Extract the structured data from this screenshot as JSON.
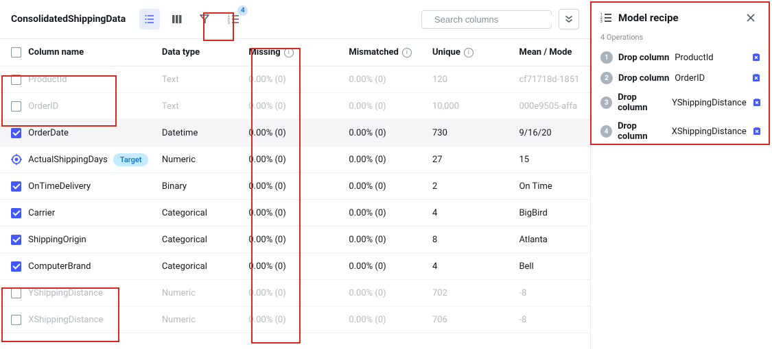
{
  "title": "ConsolidatedShippingData",
  "recipeBadge": "4",
  "search": {
    "placeholder": "Search columns"
  },
  "headers": {
    "name": "Column name",
    "type": "Data type",
    "missing": "Missing",
    "mismatched": "Mismatched",
    "unique": "Unique",
    "mean": "Mean / Mode"
  },
  "rows": [
    {
      "name": "ProductId",
      "type": "Text",
      "missing": "0.00% (0)",
      "mismatched": "0.00% (0)",
      "unique": "120",
      "mean": "cf71718d-1851",
      "checked": false,
      "target": false
    },
    {
      "name": "OrderID",
      "type": "Text",
      "missing": "0.00% (0)",
      "mismatched": "0.00% (0)",
      "unique": "10,000",
      "mean": "000e9505-affa",
      "checked": false,
      "target": false
    },
    {
      "name": "OrderDate",
      "type": "Datetime",
      "missing": "0.00% (0)",
      "mismatched": "0.00% (0)",
      "unique": "730",
      "mean": "9/16/20",
      "checked": true,
      "target": false,
      "current": true
    },
    {
      "name": "ActualShippingDays",
      "type": "Numeric",
      "missing": "0.00% (0)",
      "mismatched": "0.00% (0)",
      "unique": "27",
      "mean": "15",
      "checked": false,
      "target": true,
      "targetLabel": "Target"
    },
    {
      "name": "OnTimeDelivery",
      "type": "Binary",
      "missing": "0.00% (0)",
      "mismatched": "0.00% (0)",
      "unique": "2",
      "mean": "On Time",
      "checked": true,
      "target": false
    },
    {
      "name": "Carrier",
      "type": "Categorical",
      "missing": "0.00% (0)",
      "mismatched": "0.00% (0)",
      "unique": "4",
      "mean": "BigBird",
      "checked": true,
      "target": false
    },
    {
      "name": "ShippingOrigin",
      "type": "Categorical",
      "missing": "0.00% (0)",
      "mismatched": "0.00% (0)",
      "unique": "8",
      "mean": "Atlanta",
      "checked": true,
      "target": false
    },
    {
      "name": "ComputerBrand",
      "type": "Categorical",
      "missing": "0.00% (0)",
      "mismatched": "0.00% (0)",
      "unique": "4",
      "mean": "Bell",
      "checked": true,
      "target": false
    },
    {
      "name": "YShippingDistance",
      "type": "Numeric",
      "missing": "0.00% (0)",
      "mismatched": "0.00% (0)",
      "unique": "702",
      "mean": "-8",
      "checked": false,
      "target": false
    },
    {
      "name": "XShippingDistance",
      "type": "Numeric",
      "missing": "0.00% (0)",
      "mismatched": "0.00% (0)",
      "unique": "706",
      "mean": "-8",
      "checked": false,
      "target": false
    }
  ],
  "panel": {
    "title": "Model recipe",
    "opsCount": "4 Operations",
    "ops": [
      {
        "action": "Drop column",
        "column": "ProductId"
      },
      {
        "action": "Drop column",
        "column": "OrderID"
      },
      {
        "action": "Drop column",
        "column": "YShippingDistance"
      },
      {
        "action": "Drop column",
        "column": "XShippingDistance"
      }
    ]
  }
}
